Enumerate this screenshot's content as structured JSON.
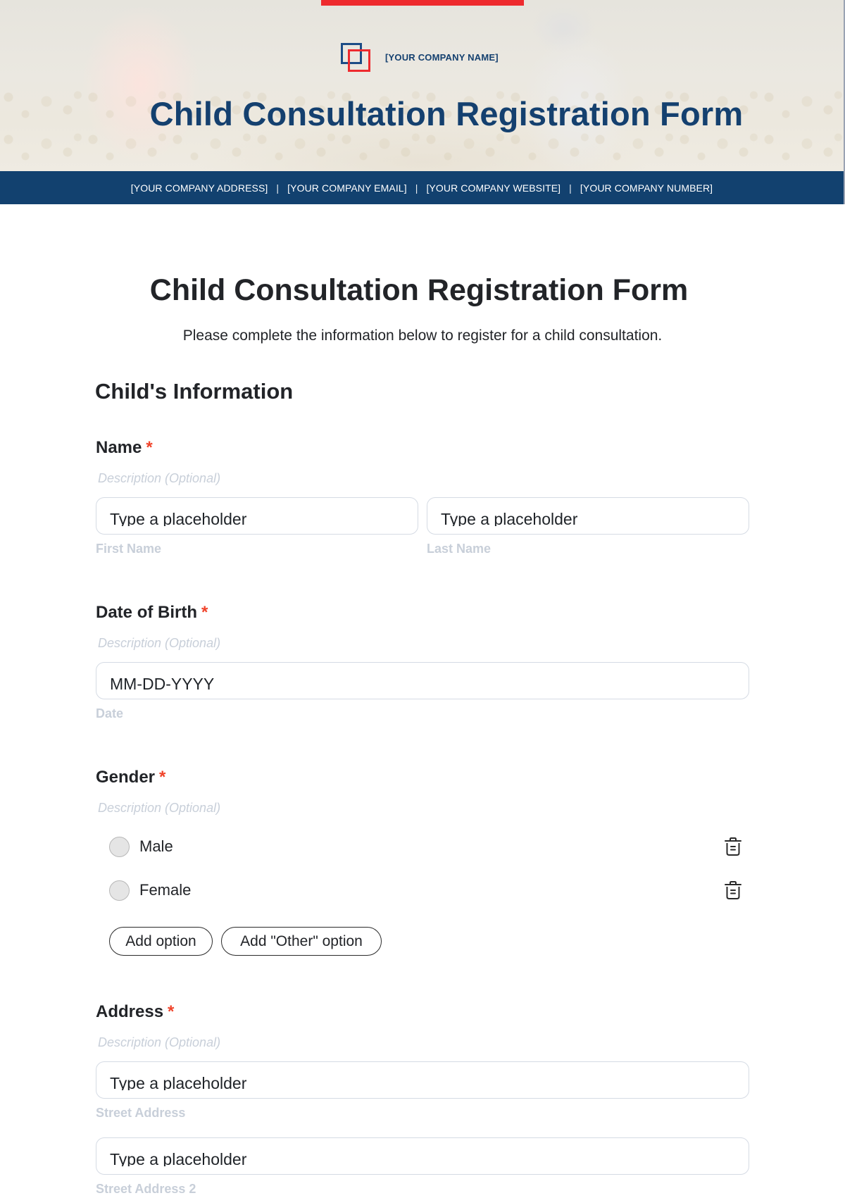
{
  "colors": {
    "brand_blue": "#14406f",
    "brand_red": "#ee2a2e",
    "required_star": "#f0432a"
  },
  "header": {
    "company_name": "[YOUR COMPANY NAME]",
    "title": "Child Consultation Registration Form",
    "contact": {
      "address": "[YOUR COMPANY ADDRESS]",
      "email": "[YOUR COMPANY EMAIL]",
      "website": "[YOUR COMPANY WEBSITE]",
      "number": "[YOUR COMPANY NUMBER]",
      "separator": "|"
    }
  },
  "form": {
    "title": "Child Consultation Registration Form",
    "subtitle": "Please complete the information below to register for a child consultation.",
    "section_title": "Child's Information",
    "required_mark": "*",
    "questions": {
      "name": {
        "label": "Name",
        "description": "Description (Optional)",
        "first": {
          "placeholder": "Type a placeholder",
          "sublabel": "First Name"
        },
        "last": {
          "placeholder": "Type a placeholder",
          "sublabel": "Last Name"
        }
      },
      "dob": {
        "label": "Date of Birth",
        "description": "Description (Optional)",
        "placeholder": "MM-DD-YYYY",
        "sublabel": "Date"
      },
      "gender": {
        "label": "Gender",
        "description": "Description (Optional)",
        "options": [
          {
            "label": "Male",
            "icon": "trash-icon"
          },
          {
            "label": "Female",
            "icon": "trash-icon"
          }
        ],
        "add_option_label": "Add option",
        "add_other_label": "Add \"Other\" option"
      },
      "address": {
        "label": "Address",
        "description": "Description (Optional)",
        "street": {
          "placeholder": "Type a placeholder",
          "sublabel": "Street Address"
        },
        "street2": {
          "placeholder": "Type a placeholder",
          "sublabel": "Street Address 2"
        }
      }
    }
  }
}
